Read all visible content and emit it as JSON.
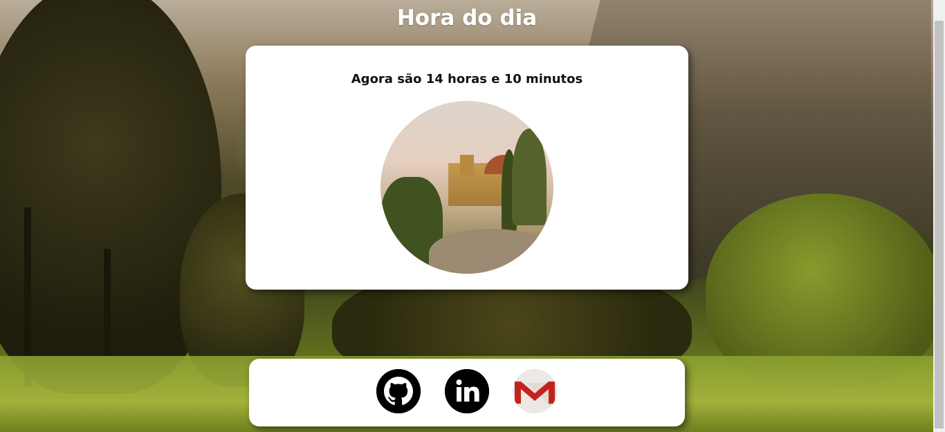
{
  "page": {
    "title": "Hora do dia",
    "time_message": "Agora são 14 horas e 10 minutos",
    "image_alt": "igreja-tarde"
  },
  "social": {
    "links": [
      {
        "name": "github",
        "icon": "github-icon"
      },
      {
        "name": "linkedin",
        "icon": "linkedin-icon"
      },
      {
        "name": "gmail",
        "icon": "gmail-icon"
      }
    ]
  },
  "colors": {
    "card_bg": "#ffffff",
    "title_color": "#ffffff",
    "text_color": "#111111",
    "gmail_red": "#c5221f"
  }
}
